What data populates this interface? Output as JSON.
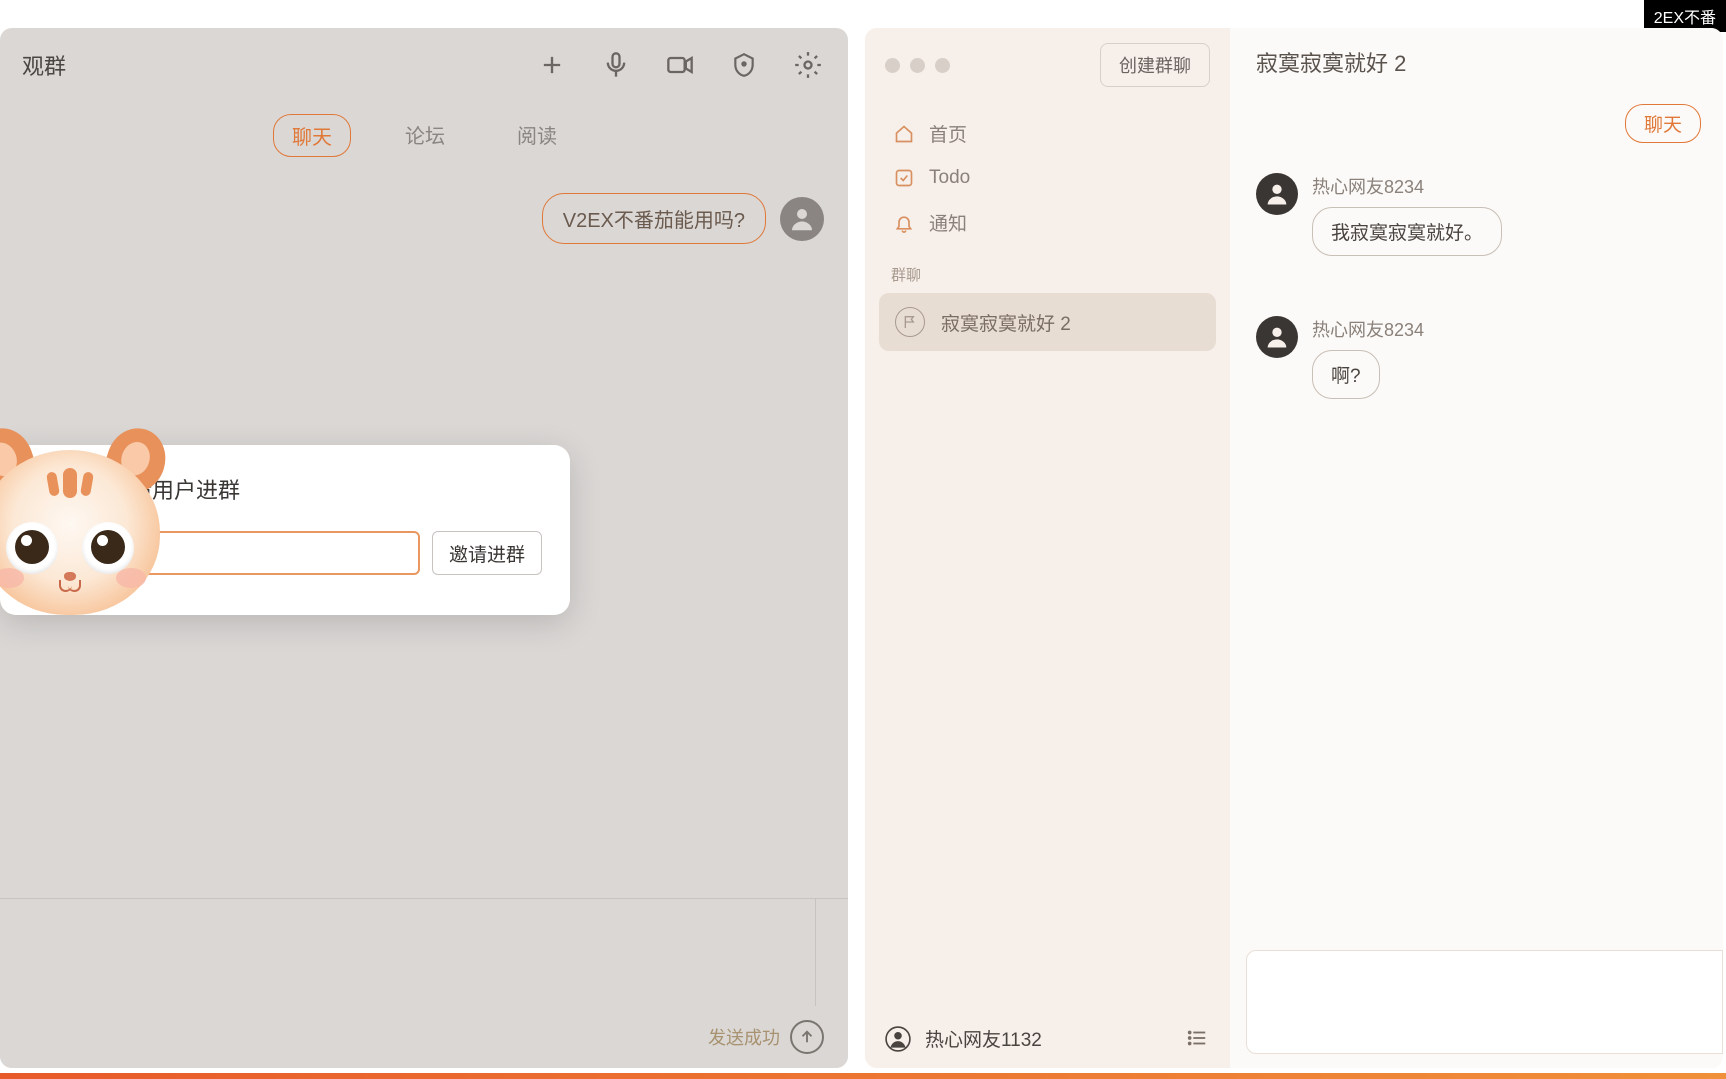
{
  "top_badge": "2EX不番",
  "left_window": {
    "title": "观群",
    "tabs": [
      "聊天",
      "论坛",
      "阅读"
    ],
    "active_tab_index": 0,
    "outgoing_message": "V2EX不番茄能用吗?",
    "send_status": "发送成功"
  },
  "modal": {
    "title": "请用户进群",
    "input_value": "",
    "button_label": "邀请进群"
  },
  "right_window": {
    "create_group_label": "创建群聊",
    "nav": [
      {
        "icon": "home",
        "label": "首页"
      },
      {
        "icon": "check",
        "label": "Todo"
      },
      {
        "icon": "bell",
        "label": "通知"
      }
    ],
    "group_section_label": "群聊",
    "groups": [
      {
        "name": "寂寞寂寞就好 2"
      }
    ],
    "footer_user": "热心网友1132",
    "main_title": "寂寞寂寞就好 2",
    "main_tabs": [
      "聊天"
    ],
    "messages": [
      {
        "sender": "热心网友8234",
        "text": "我寂寞寂寞就好。"
      },
      {
        "sender": "热心网友8234",
        "text": "啊?"
      }
    ]
  }
}
